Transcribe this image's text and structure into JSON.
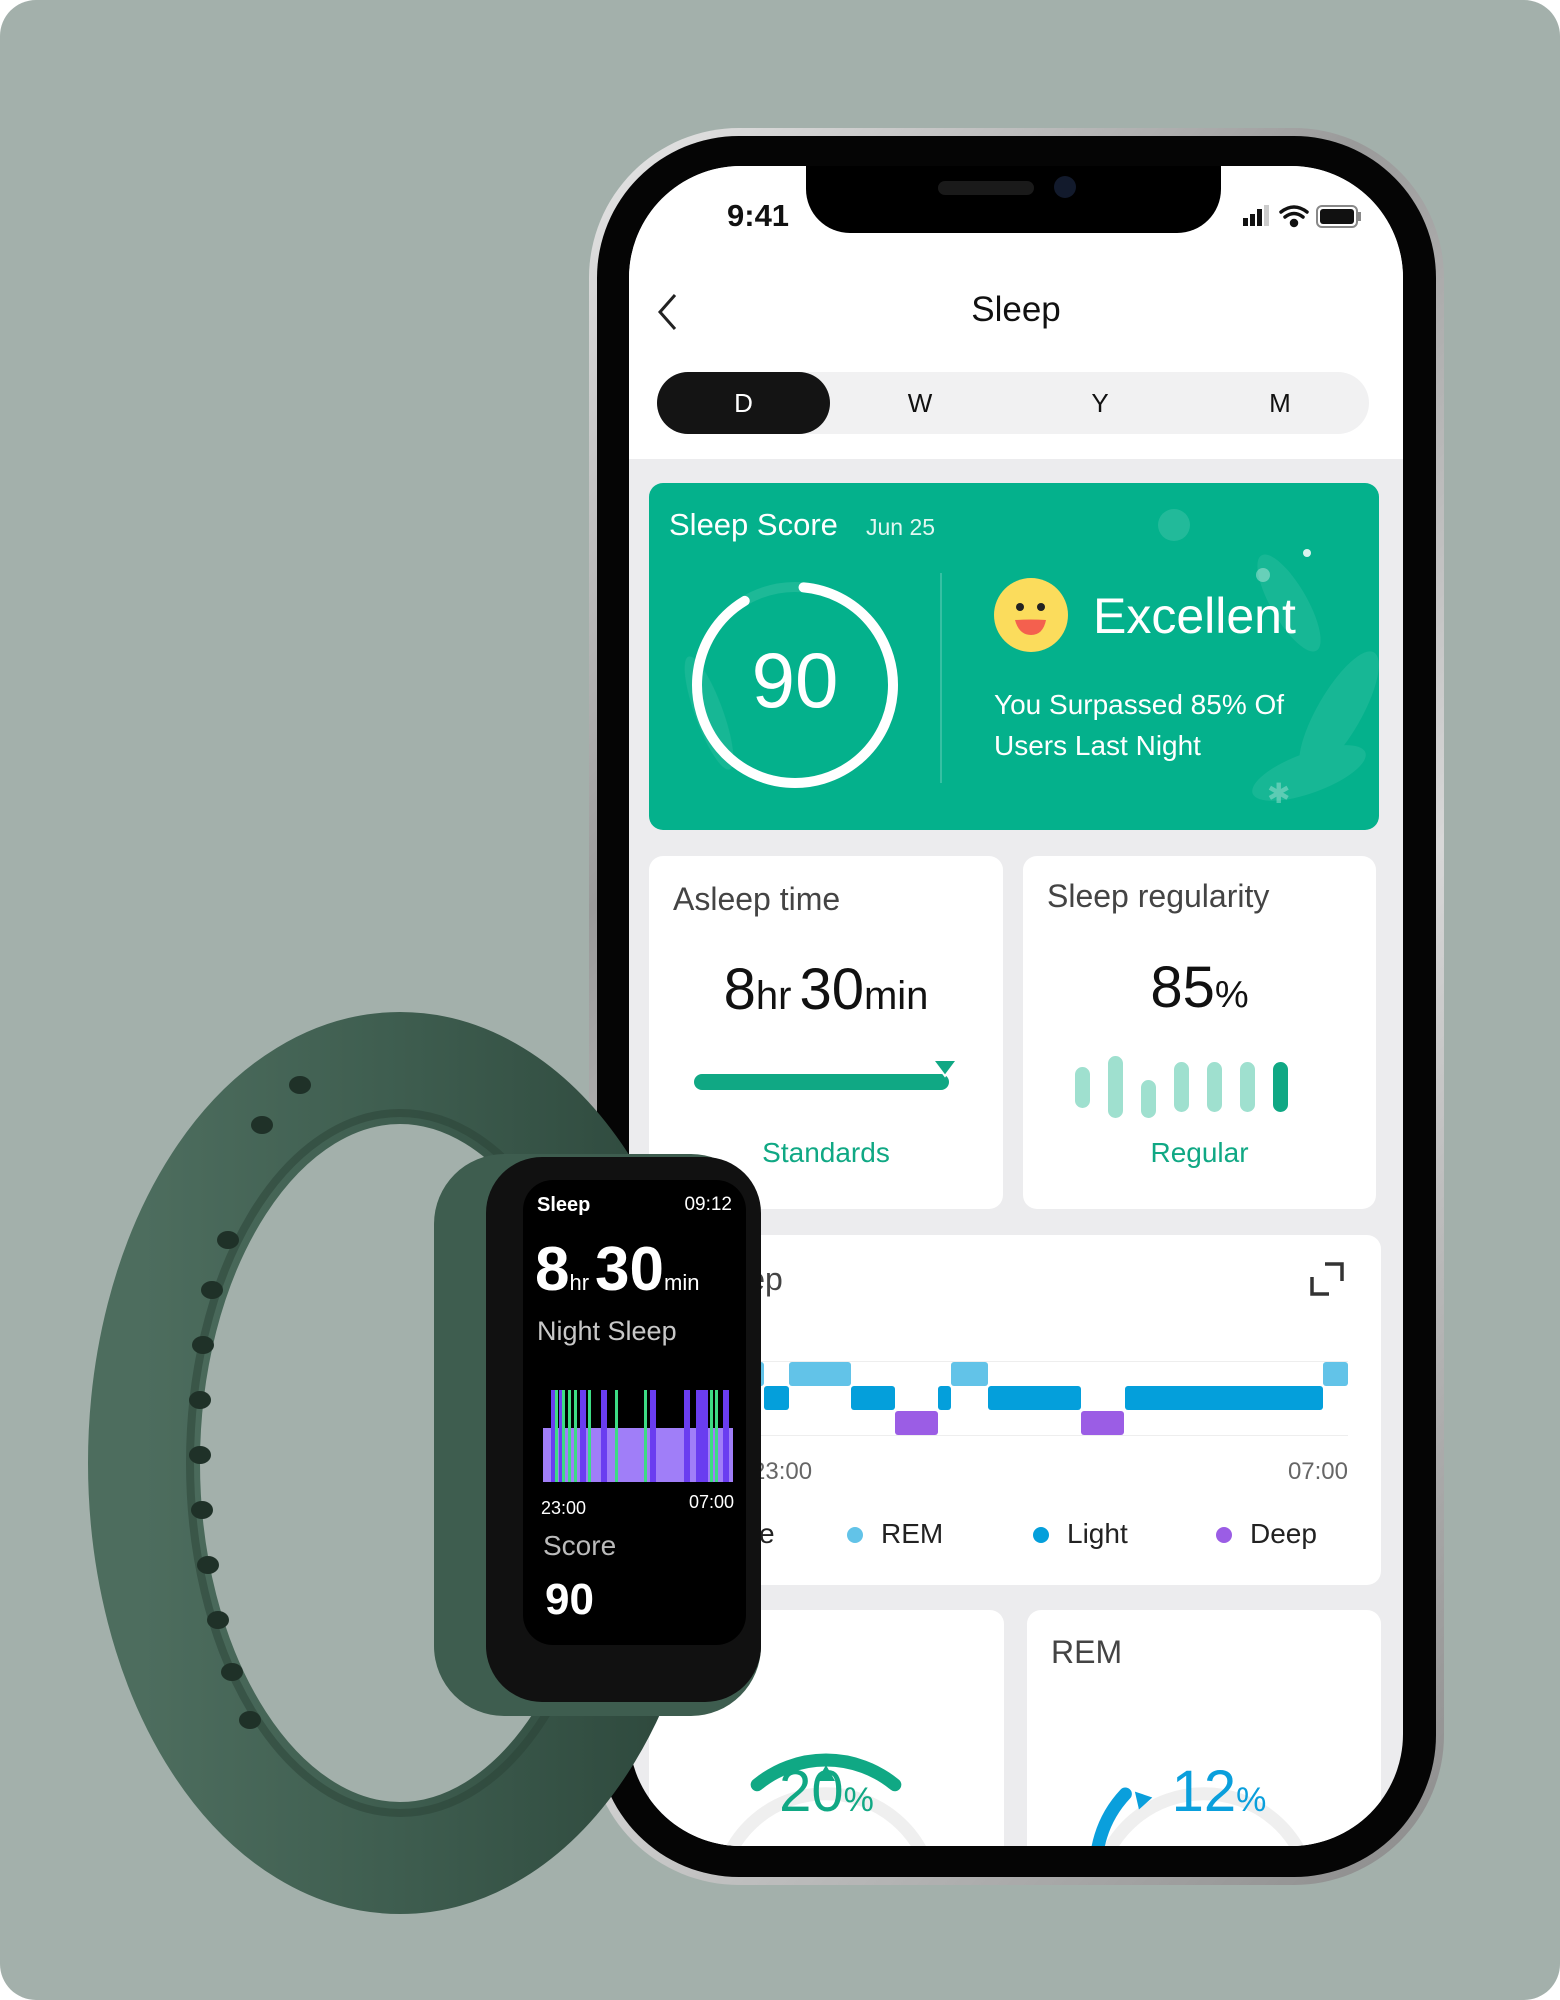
{
  "status_bar": {
    "time": "9:41",
    "signal_icon": "cellular-signal-icon",
    "wifi_icon": "wifi-icon",
    "battery_icon": "battery-icon"
  },
  "header": {
    "title": "Sleep",
    "back_icon": "chevron-left-icon"
  },
  "period_tabs": {
    "items": [
      {
        "label": "D",
        "active": true
      },
      {
        "label": "W",
        "active": false
      },
      {
        "label": "Y",
        "active": false
      },
      {
        "label": "M",
        "active": false
      }
    ]
  },
  "score_card": {
    "title": "Sleep Score",
    "date": "Jun 25",
    "score": "90",
    "score_value": 90,
    "score_max": 100,
    "rating": "Excellent",
    "rating_icon": "smiling-face-icon",
    "message_line1": "You Surpassed 85% Of",
    "message_line2": "Users Last Night",
    "color": "#04b18c"
  },
  "asleep_card": {
    "title": "Asleep time",
    "hours": "8",
    "hours_unit": "hr",
    "minutes": "30",
    "minutes_unit": "min",
    "status": "Standards",
    "progress": 1.0
  },
  "regularity_card": {
    "title": "Sleep regularity",
    "value": "85",
    "unit": "%",
    "status": "Regular",
    "bar_levels": [
      0.5,
      1.0,
      0.45,
      0.7,
      0.7,
      0.7,
      0.7
    ]
  },
  "stages_card": {
    "title": "Sleep",
    "expand_icon": "expand-icon",
    "chart_data": {
      "type": "timeline",
      "x_start": "23:00",
      "x_end": "07:00",
      "tick_labels": [
        "23:00",
        "07:00"
      ],
      "rows": [
        "REM",
        "Light",
        "Deep"
      ],
      "segments": [
        {
          "stage": "REM",
          "start": "23:00",
          "end": "23:10"
        },
        {
          "stage": "Light",
          "start": "23:10",
          "end": "23:30"
        },
        {
          "stage": "REM",
          "start": "23:30",
          "end": "00:20"
        },
        {
          "stage": "Light",
          "start": "00:20",
          "end": "00:55"
        },
        {
          "stage": "Deep",
          "start": "00:55",
          "end": "01:30"
        },
        {
          "stage": "Light",
          "start": "01:30",
          "end": "01:40"
        },
        {
          "stage": "REM",
          "start": "01:40",
          "end": "02:10"
        },
        {
          "stage": "Light",
          "start": "02:10",
          "end": "03:25"
        },
        {
          "stage": "Deep",
          "start": "03:25",
          "end": "04:00"
        },
        {
          "stage": "Light",
          "start": "04:00",
          "end": "06:40"
        },
        {
          "stage": "REM",
          "start": "06:40",
          "end": "07:00"
        }
      ],
      "legend": [
        {
          "label": "Wake",
          "color": "#f5a623"
        },
        {
          "label": "REM",
          "color": "#62c3e8"
        },
        {
          "label": "Light",
          "color": "#049fdb"
        },
        {
          "label": "Deep",
          "color": "#9b5de5"
        }
      ]
    }
  },
  "deep_card": {
    "value": "20",
    "unit": "%",
    "color": "#10a884",
    "percent": 20
  },
  "rem_card": {
    "title": "REM",
    "value": "12",
    "unit": "%",
    "color": "#0a9fdc",
    "percent": 12
  },
  "watch": {
    "title": "Sleep",
    "time": "09:12",
    "hours": "8",
    "hours_unit": "hr",
    "minutes": "30",
    "minutes_unit": "min",
    "subtitle": "Night Sleep",
    "start": "23:00",
    "end": "07:00",
    "score_label": "Score",
    "score": "90",
    "spikes": [
      {
        "time": "23:20",
        "stage": "deep"
      },
      {
        "time": "23:30",
        "stage": "awake"
      },
      {
        "time": "23:40",
        "stage": "deep"
      },
      {
        "time": "23:50",
        "stage": "awake"
      },
      {
        "time": "00:05",
        "stage": "awake"
      },
      {
        "time": "00:20",
        "stage": "awake"
      },
      {
        "time": "00:35",
        "stage": "deep"
      },
      {
        "time": "00:55",
        "stage": "awake"
      },
      {
        "time": "01:30",
        "stage": "deep"
      },
      {
        "time": "02:05",
        "stage": "awake"
      },
      {
        "time": "03:20",
        "stage": "awake"
      },
      {
        "time": "03:35",
        "stage": "deep"
      },
      {
        "time": "05:05",
        "stage": "deep"
      },
      {
        "time": "05:35",
        "stage": "deep"
      },
      {
        "time": "05:50",
        "stage": "deep"
      },
      {
        "time": "06:10",
        "stage": "awake"
      },
      {
        "time": "06:25",
        "stage": "awake"
      },
      {
        "time": "06:45",
        "stage": "deep"
      }
    ]
  }
}
